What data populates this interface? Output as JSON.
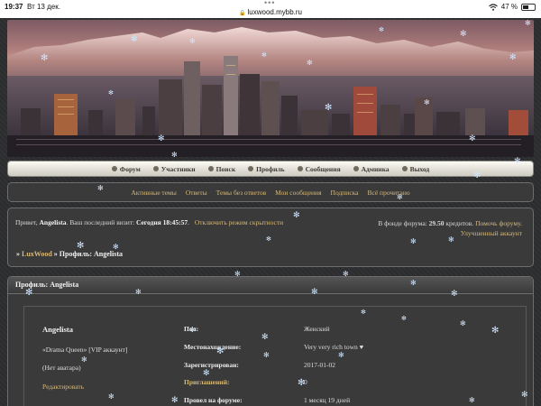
{
  "status_bar": {
    "time": "19:37",
    "date": "Вт 13 дек.",
    "url": "luxwood.mybb.ru",
    "battery": "47 %",
    "battery_level": 0.47
  },
  "nav": {
    "items": [
      {
        "label": "Форум",
        "icon": "bullet-icon"
      },
      {
        "label": "Участники",
        "icon": "bullet-icon"
      },
      {
        "label": "Поиск",
        "icon": "bullet-icon"
      },
      {
        "label": "Профиль",
        "icon": "bullet-icon"
      },
      {
        "label": "Сообщения",
        "icon": "bullet-icon"
      },
      {
        "label": "Админка",
        "icon": "bullet-icon"
      },
      {
        "label": "Выход",
        "icon": "bullet-icon"
      }
    ]
  },
  "links": [
    "Активные темы",
    "Ответы",
    "Темы без ответов",
    "Мои сообщения",
    "Подписка",
    "Всё прочитано"
  ],
  "welcome": {
    "greeting": "Привет,",
    "username": "Angelista",
    "last_visit_label": ". Ваш последний визит:",
    "last_visit_value": "Сегодня 18:45:57",
    "hidden_mode_link": "Отключить режим скрытности"
  },
  "fund": {
    "prefix": "В фонде форума:",
    "amount": "29.50",
    "suffix": "кредитов.",
    "help_link": "Помочь форуму.",
    "premium_link": "Улучшенный аккаунт"
  },
  "breadcrumb": {
    "prefix": "»",
    "forum_link": "LuxWood",
    "separator": "»",
    "current": "Профиль: Angelista"
  },
  "profile": {
    "header": "Профиль: Angelista",
    "name": "Angelista",
    "rank": "«Drama Queen» [VIP аккаунт]",
    "avatar": "(Нет аватара)",
    "edit_link": "Редактировать",
    "fields": [
      {
        "label": "Пол:",
        "value": "Женский",
        "highlight": false
      },
      {
        "label": "Местонахождение:",
        "value": "Very very rich town ♥",
        "highlight": false
      },
      {
        "label": "Зарегистрирован:",
        "value": "2017-01-02",
        "highlight": false
      },
      {
        "label": "Приглашений:",
        "value": "0",
        "highlight": true
      },
      {
        "label": "Провел на форуме:",
        "value": "1 месяц 19 дней",
        "highlight": false
      }
    ]
  },
  "colors": {
    "link": "#d6b97a",
    "background": "#2c2d2f",
    "panel": "#3a3a3a",
    "snow": "#cfe6ff"
  }
}
